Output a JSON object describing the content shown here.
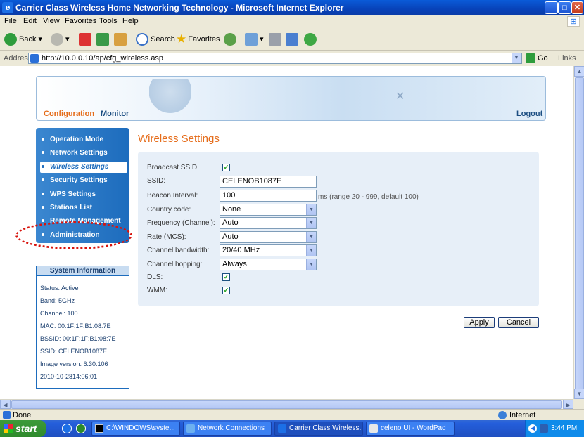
{
  "window": {
    "title": "Carrier Class Wireless Home Networking Technology - Microsoft Internet Explorer",
    "buttons": {
      "minimize": "_",
      "maximize": "□",
      "close": "✕"
    }
  },
  "menu": [
    "File",
    "Edit",
    "View",
    "Favorites",
    "Tools",
    "Help"
  ],
  "toolbar": {
    "back": "Back",
    "search": "Search",
    "favorites": "Favorites"
  },
  "address": {
    "label": "Address",
    "url": "http://10.0.0.10/ap/cfg_wireless.asp",
    "go": "Go",
    "links": "Links"
  },
  "header": {
    "configuration": "Configuration",
    "monitor": "Monitor",
    "logout": "Logout"
  },
  "sidebar": {
    "items": [
      {
        "label": "Operation Mode"
      },
      {
        "label": "Network Settings"
      },
      {
        "label": "Wireless Settings"
      },
      {
        "label": "Security Settings"
      },
      {
        "label": "WPS Settings"
      },
      {
        "label": "Stations List"
      },
      {
        "label": "Remote Management"
      },
      {
        "label": "Administration"
      }
    ]
  },
  "system_info": {
    "title": "System Information",
    "lines": [
      "Status: Active",
      "Band: 5GHz",
      "Channel: 100",
      "MAC: 00:1F:1F:B1:08:7E",
      "BSSID: 00:1F:1F:B1:08:7E",
      "SSID: CELENOB1087E",
      "Image version: 6.30.106",
      "2010-10-2814:06:01"
    ]
  },
  "page": {
    "title": "Wireless Settings"
  },
  "form": {
    "broadcast_ssid": {
      "label": "Broadcast SSID:",
      "checked": true
    },
    "ssid": {
      "label": "SSID:",
      "value": "CELENOB1087E"
    },
    "beacon_interval": {
      "label": "Beacon Interval:",
      "value": "100",
      "hint": "ms (range 20 - 999, default 100)"
    },
    "country_code": {
      "label": "Country code:",
      "value": "None"
    },
    "frequency": {
      "label": "Frequency (Channel):",
      "value": "Auto"
    },
    "rate": {
      "label": "Rate (MCS):",
      "value": "Auto"
    },
    "channel_bandwidth": {
      "label": "Channel bandwidth:",
      "value": "20/40 MHz"
    },
    "channel_hopping": {
      "label": "Channel hopping:",
      "value": "Always"
    },
    "dls": {
      "label": "DLS:",
      "checked": true
    },
    "wmm": {
      "label": "WMM:",
      "checked": true
    },
    "apply": "Apply",
    "cancel": "Cancel"
  },
  "status": {
    "left": "Done",
    "zone": "Internet"
  },
  "taskbar": {
    "start": "start",
    "tasks": [
      "C:\\WINDOWS\\syste...",
      "Network Connections",
      "Carrier Class Wireless...",
      "celeno UI - WordPad"
    ],
    "clock": "3:44 PM"
  }
}
